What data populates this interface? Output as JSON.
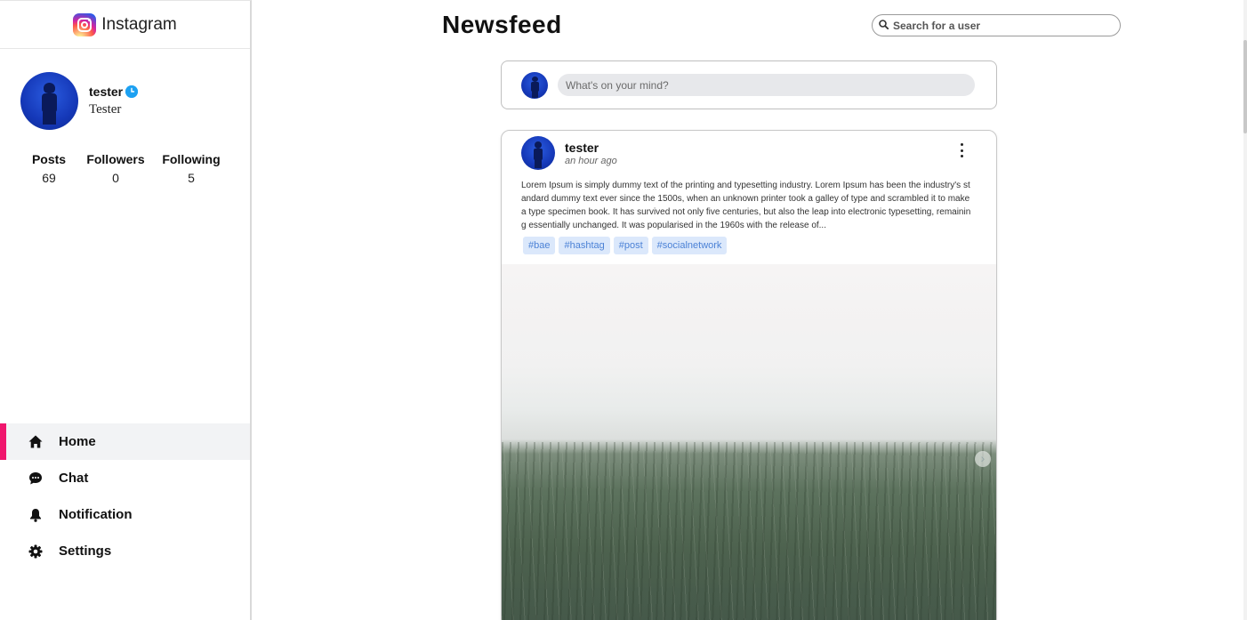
{
  "brand": {
    "name": "Instagram",
    "icon": "instagram-logo-icon"
  },
  "profile": {
    "name": "tester",
    "handle": "Tester",
    "verified_icon": "verified-icon",
    "stats": [
      {
        "label": "Posts",
        "value": "69"
      },
      {
        "label": "Followers",
        "value": "0"
      },
      {
        "label": "Following",
        "value": "5"
      }
    ]
  },
  "nav": {
    "items": [
      {
        "label": "Home",
        "icon": "home-icon",
        "active": true
      },
      {
        "label": "Chat",
        "icon": "chat-icon",
        "active": false
      },
      {
        "label": "Notification",
        "icon": "bell-icon",
        "active": false
      },
      {
        "label": "Settings",
        "icon": "gear-icon",
        "active": false
      }
    ],
    "accent_color": "#f0166d"
  },
  "header": {
    "title": "Newsfeed",
    "search_placeholder": "Search for a user"
  },
  "composer": {
    "placeholder": "What's on your mind?"
  },
  "post": {
    "author": "tester",
    "time": "an hour ago",
    "text": "Lorem Ipsum is simply dummy text of the printing and typesetting industry. Lorem Ipsum has been the industry's standard dummy text ever since the 1500s, when an unknown printer took a galley of type and scrambled it to make a type specimen book. It has survived not only five centuries, but also the leap into electronic typesetting, remaining essentially unchanged. It was popularised in the 1960s with the release of...",
    "tags": [
      "#bae",
      "#hashtag",
      "#post",
      "#socialnetwork"
    ]
  },
  "colors": {
    "tag_bg": "#dbe8fb",
    "tag_text": "#4c82d6",
    "verified": "#1da1f2"
  }
}
